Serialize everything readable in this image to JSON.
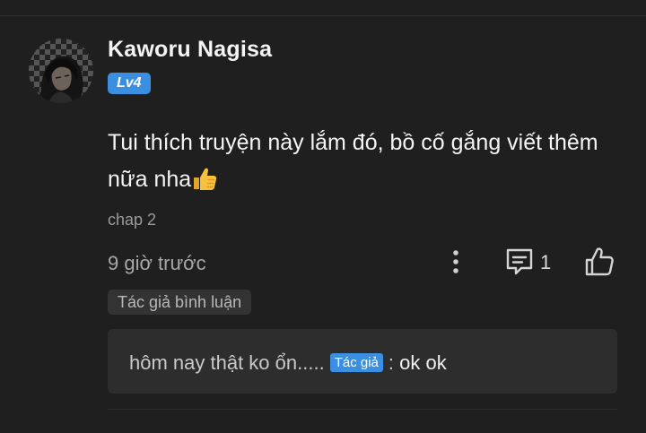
{
  "user": {
    "name": "Kaworu Nagisa",
    "level": "Lv4"
  },
  "comment": {
    "text": "Tui thích truyện này lắm đó, bồ cố gắng viết thêm nữa nha",
    "emoji": "thumbs-up-emoji",
    "chapter": "chap 2",
    "time": "9 giờ trước",
    "reply_count": "1",
    "author_tag": "Tác giả bình luận"
  },
  "reply": {
    "prefix": "hôm nay thật ko ổn.....",
    "badge": "Tác giả",
    "separator": ":",
    "text": "ok ok"
  },
  "colors": {
    "background": "#1f1f1f",
    "accent": "#3b8fe0",
    "reply_background": "#2d2d2d"
  },
  "icons": {
    "more": "more-vertical-icon",
    "reply": "comment-icon",
    "like": "thumbs-up-icon"
  }
}
